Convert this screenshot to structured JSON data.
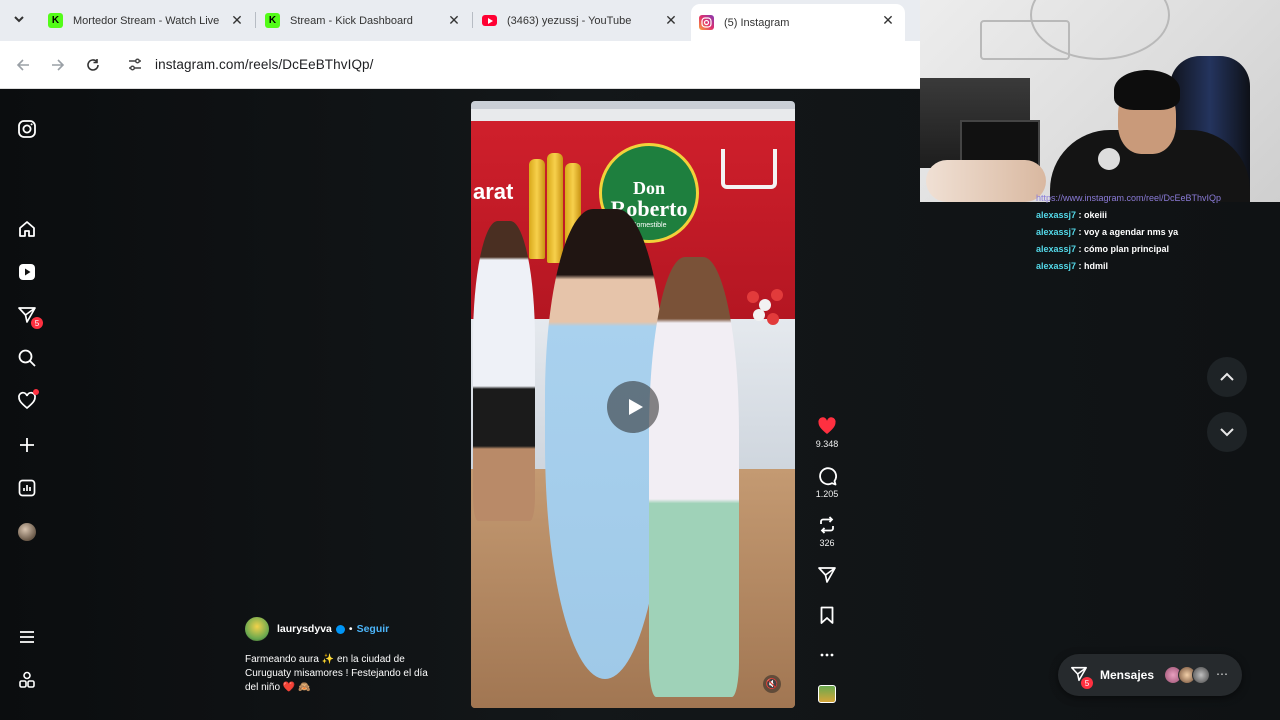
{
  "browser": {
    "tabs": [
      {
        "title": "Mortedor Stream - Watch Live on",
        "favicon": "kick-icon"
      },
      {
        "title": "Stream - Kick Dashboard",
        "favicon": "kick-icon"
      },
      {
        "title": "(3463) yezussj - YouTube",
        "favicon": "youtube-icon"
      },
      {
        "title": "(5) Instagram",
        "favicon": "instagram-icon",
        "active": true
      }
    ],
    "url": "instagram.com/reels/DcEeBThvIQp/"
  },
  "sidebar": {
    "notifications_badge": "5"
  },
  "reel": {
    "username": "laurysdyva",
    "separator": "•",
    "follow_label": "Seguir",
    "caption_line1": "Farmeando aura ✨ en la ciudad de",
    "caption_line2": "Curuguaty misamores ! Festejando el día",
    "caption_line3": "del niño ❤️ 🙈",
    "likes": "9.348",
    "comments": "1.205",
    "reposts": "326",
    "mute_icon": "🔇"
  },
  "video_scene": {
    "brand_line1": "Don",
    "brand_line2": "Roberto",
    "sign_left": "arat",
    "sign_sub": "Comestible"
  },
  "messages": {
    "label": "Mensajes",
    "badge": "5",
    "more": "⋯"
  },
  "stream_chat": {
    "top_link": "https://www.instagram.com/reel/DcEeBThvIQp",
    "lines": [
      {
        "user": "alexassj7",
        "text": " : okeiii"
      },
      {
        "user": "alexassj7",
        "text": " : voy a agendar nms ya"
      },
      {
        "user": "alexassj7",
        "text": " : cómo plan principal"
      },
      {
        "user": "alexassj7",
        "text": " : hdmil"
      }
    ]
  },
  "colors": {
    "like_red": "#ff3040",
    "follow_blue": "#4cb5f9",
    "kick_green": "#53fc18",
    "youtube_red": "#ff0033",
    "chat_user": "#53d8e8"
  }
}
